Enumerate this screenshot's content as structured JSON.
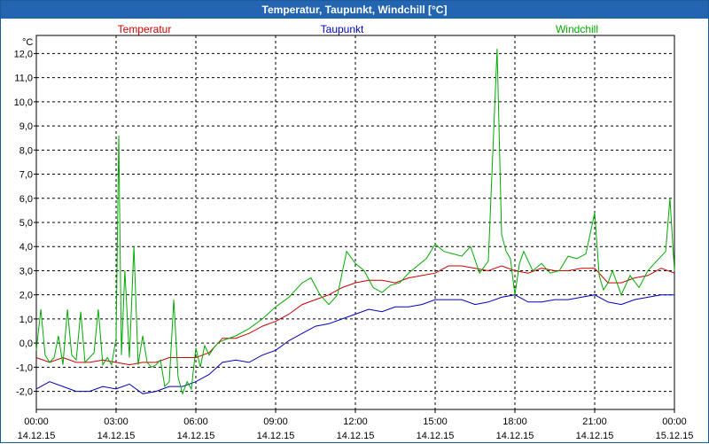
{
  "window": {
    "title": "Temperatur, Taupunkt, Windchill [°C]"
  },
  "chart_data": {
    "type": "line",
    "title": "Temperatur, Taupunkt, Windchill [°C]",
    "ylabel": "°C",
    "xlabel": "",
    "ylim": [
      -2.75,
      12.75
    ],
    "xlim": [
      0,
      24
    ],
    "grid": true,
    "legend_position": "top",
    "y_ticks": [
      "-2,0",
      "-1,0",
      "0,0",
      "1,0",
      "2,0",
      "3,0",
      "4,0",
      "5,0",
      "6,0",
      "7,0",
      "8,0",
      "9,0",
      "10,0",
      "11,0",
      "12,0"
    ],
    "y_tick_values": [
      -2,
      -1,
      0,
      1,
      2,
      3,
      4,
      5,
      6,
      7,
      8,
      9,
      10,
      11,
      12
    ],
    "x_ticks": [
      {
        "time": "00:00",
        "date": "14.12.15",
        "hour": 0
      },
      {
        "time": "03:00",
        "date": "14.12.15",
        "hour": 3
      },
      {
        "time": "06:00",
        "date": "14.12.15",
        "hour": 6
      },
      {
        "time": "09:00",
        "date": "14.12.15",
        "hour": 9
      },
      {
        "time": "12:00",
        "date": "14.12.15",
        "hour": 12
      },
      {
        "time": "15:00",
        "date": "14.12.15",
        "hour": 15
      },
      {
        "time": "18:00",
        "date": "14.12.15",
        "hour": 18
      },
      {
        "time": "21:00",
        "date": "14.12.15",
        "hour": 21
      },
      {
        "time": "00:00",
        "date": "15.12.15",
        "hour": 24
      }
    ],
    "series": [
      {
        "name": "Temperatur",
        "color": "#cc0000",
        "x": [
          0,
          0.5,
          1,
          1.5,
          2,
          2.5,
          3,
          3.5,
          4,
          4.5,
          5,
          5.5,
          6,
          6.5,
          7,
          7.5,
          8,
          8.5,
          9,
          9.5,
          10,
          10.5,
          11,
          11.5,
          12,
          12.5,
          13,
          13.5,
          14,
          14.5,
          15,
          15.5,
          16,
          16.5,
          17,
          17.5,
          18,
          18.5,
          19,
          19.5,
          20,
          20.5,
          21,
          21.5,
          22,
          22.5,
          23,
          23.5,
          24
        ],
        "values": [
          -0.6,
          -0.8,
          -0.6,
          -0.8,
          -0.8,
          -0.7,
          -0.8,
          -0.9,
          -0.8,
          -0.8,
          -0.6,
          -0.6,
          -0.6,
          -0.4,
          0.2,
          0.2,
          0.4,
          0.7,
          0.9,
          1.2,
          1.6,
          1.8,
          2.0,
          2.3,
          2.5,
          2.6,
          2.6,
          2.5,
          2.7,
          2.8,
          2.9,
          3.2,
          3.2,
          3.1,
          3.0,
          3.2,
          3.0,
          2.9,
          3.1,
          3.0,
          3.0,
          3.1,
          3.1,
          2.5,
          2.5,
          2.7,
          2.8,
          3.1,
          2.9
        ]
      },
      {
        "name": "Taupunkt",
        "color": "#0000bb",
        "x": [
          0,
          0.5,
          1,
          1.5,
          2,
          2.5,
          3,
          3.5,
          4,
          4.5,
          5,
          5.5,
          6,
          6.5,
          7,
          7.5,
          8,
          8.5,
          9,
          9.5,
          10,
          10.5,
          11,
          11.5,
          12,
          12.5,
          13,
          13.5,
          14,
          14.5,
          15,
          15.5,
          16,
          16.5,
          17,
          17.5,
          18,
          18.5,
          19,
          19.5,
          20,
          20.5,
          21,
          21.5,
          22,
          22.5,
          23,
          23.5,
          24
        ],
        "values": [
          -1.9,
          -1.6,
          -1.8,
          -2.0,
          -2.0,
          -1.8,
          -1.9,
          -1.7,
          -2.1,
          -2.0,
          -1.8,
          -1.8,
          -1.6,
          -1.3,
          -0.8,
          -0.7,
          -0.8,
          -0.5,
          -0.3,
          0.1,
          0.4,
          0.7,
          0.8,
          1.0,
          1.2,
          1.4,
          1.3,
          1.5,
          1.5,
          1.6,
          1.8,
          1.8,
          1.8,
          1.6,
          1.7,
          1.9,
          2.0,
          1.7,
          1.7,
          1.8,
          1.8,
          1.9,
          2.0,
          1.7,
          1.6,
          1.8,
          1.9,
          2.0,
          2.0
        ]
      },
      {
        "name": "Windchill",
        "color": "#00aa00",
        "x": [
          0,
          0.17,
          0.33,
          0.5,
          0.67,
          0.83,
          1,
          1.17,
          1.33,
          1.5,
          1.67,
          1.83,
          2,
          2.17,
          2.33,
          2.5,
          2.67,
          2.83,
          3,
          3.1,
          3.2,
          3.33,
          3.5,
          3.67,
          3.83,
          4,
          4.17,
          4.33,
          4.5,
          4.67,
          4.83,
          5,
          5.17,
          5.33,
          5.5,
          5.67,
          5.83,
          6,
          6.17,
          6.33,
          6.5,
          6.67,
          6.83,
          7,
          7.5,
          8,
          8.5,
          9,
          9.5,
          10,
          10.33,
          10.67,
          11,
          11.33,
          11.67,
          12,
          12.33,
          12.67,
          13,
          13.33,
          13.67,
          14,
          14.33,
          14.67,
          15,
          15.33,
          15.67,
          16,
          16.33,
          16.67,
          17,
          17.33,
          17.5,
          17.67,
          17.83,
          18,
          18.17,
          18.33,
          18.67,
          19,
          19.33,
          19.67,
          20,
          20.33,
          20.67,
          21,
          21.17,
          21.33,
          21.5,
          21.67,
          22,
          22.33,
          22.67,
          23,
          23.33,
          23.67,
          23.83,
          24
        ],
        "values": [
          -0.3,
          1.4,
          -0.5,
          -0.8,
          -0.6,
          0.3,
          -0.9,
          1.4,
          -0.5,
          -0.7,
          1.3,
          -0.8,
          -0.6,
          -0.4,
          1.4,
          -0.9,
          -0.6,
          -0.9,
          0.2,
          8.6,
          -0.5,
          3.0,
          -0.6,
          4.0,
          -0.9,
          0.3,
          -0.8,
          -1.0,
          -0.9,
          -0.7,
          -1.8,
          -1.6,
          1.8,
          -1.4,
          -2.1,
          -1.6,
          -1.9,
          -0.2,
          -1.0,
          -0.1,
          -0.5,
          -0.2,
          0.0,
          0.1,
          0.3,
          0.6,
          1.0,
          1.5,
          1.9,
          2.5,
          2.7,
          2.0,
          1.6,
          2.0,
          3.8,
          3.3,
          3.0,
          2.3,
          2.1,
          2.4,
          2.5,
          2.9,
          3.2,
          3.5,
          4.1,
          3.8,
          3.7,
          3.6,
          4.0,
          2.9,
          3.4,
          12.2,
          4.5,
          3.8,
          3.5,
          2.0,
          3.3,
          3.8,
          3.0,
          3.3,
          2.9,
          3.0,
          3.6,
          3.5,
          3.7,
          5.4,
          2.8,
          2.2,
          2.5,
          3.0,
          2.0,
          2.8,
          2.3,
          3.0,
          3.4,
          3.8,
          6.0,
          3.0
        ]
      }
    ]
  }
}
